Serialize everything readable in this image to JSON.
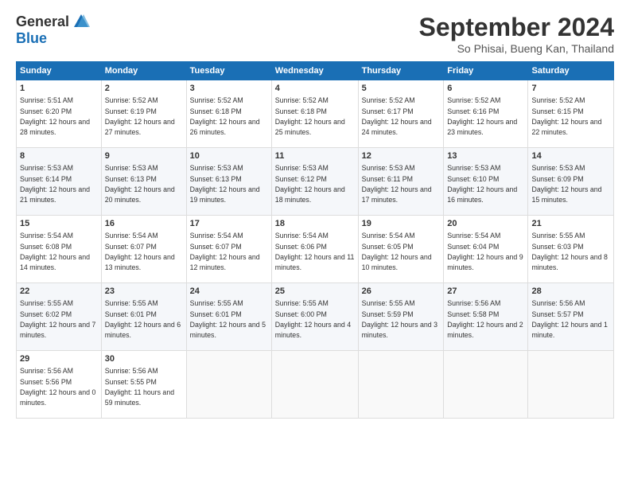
{
  "logo": {
    "general": "General",
    "blue": "Blue"
  },
  "header": {
    "month": "September 2024",
    "location": "So Phisai, Bueng Kan, Thailand"
  },
  "weekdays": [
    "Sunday",
    "Monday",
    "Tuesday",
    "Wednesday",
    "Thursday",
    "Friday",
    "Saturday"
  ],
  "weeks": [
    [
      {
        "day": "1",
        "sunrise": "5:51 AM",
        "sunset": "6:20 PM",
        "daylight": "12 hours and 28 minutes."
      },
      {
        "day": "2",
        "sunrise": "5:52 AM",
        "sunset": "6:19 PM",
        "daylight": "12 hours and 27 minutes."
      },
      {
        "day": "3",
        "sunrise": "5:52 AM",
        "sunset": "6:18 PM",
        "daylight": "12 hours and 26 minutes."
      },
      {
        "day": "4",
        "sunrise": "5:52 AM",
        "sunset": "6:18 PM",
        "daylight": "12 hours and 25 minutes."
      },
      {
        "day": "5",
        "sunrise": "5:52 AM",
        "sunset": "6:17 PM",
        "daylight": "12 hours and 24 minutes."
      },
      {
        "day": "6",
        "sunrise": "5:52 AM",
        "sunset": "6:16 PM",
        "daylight": "12 hours and 23 minutes."
      },
      {
        "day": "7",
        "sunrise": "5:52 AM",
        "sunset": "6:15 PM",
        "daylight": "12 hours and 22 minutes."
      }
    ],
    [
      {
        "day": "8",
        "sunrise": "5:53 AM",
        "sunset": "6:14 PM",
        "daylight": "12 hours and 21 minutes."
      },
      {
        "day": "9",
        "sunrise": "5:53 AM",
        "sunset": "6:13 PM",
        "daylight": "12 hours and 20 minutes."
      },
      {
        "day": "10",
        "sunrise": "5:53 AM",
        "sunset": "6:13 PM",
        "daylight": "12 hours and 19 minutes."
      },
      {
        "day": "11",
        "sunrise": "5:53 AM",
        "sunset": "6:12 PM",
        "daylight": "12 hours and 18 minutes."
      },
      {
        "day": "12",
        "sunrise": "5:53 AM",
        "sunset": "6:11 PM",
        "daylight": "12 hours and 17 minutes."
      },
      {
        "day": "13",
        "sunrise": "5:53 AM",
        "sunset": "6:10 PM",
        "daylight": "12 hours and 16 minutes."
      },
      {
        "day": "14",
        "sunrise": "5:53 AM",
        "sunset": "6:09 PM",
        "daylight": "12 hours and 15 minutes."
      }
    ],
    [
      {
        "day": "15",
        "sunrise": "5:54 AM",
        "sunset": "6:08 PM",
        "daylight": "12 hours and 14 minutes."
      },
      {
        "day": "16",
        "sunrise": "5:54 AM",
        "sunset": "6:07 PM",
        "daylight": "12 hours and 13 minutes."
      },
      {
        "day": "17",
        "sunrise": "5:54 AM",
        "sunset": "6:07 PM",
        "daylight": "12 hours and 12 minutes."
      },
      {
        "day": "18",
        "sunrise": "5:54 AM",
        "sunset": "6:06 PM",
        "daylight": "12 hours and 11 minutes."
      },
      {
        "day": "19",
        "sunrise": "5:54 AM",
        "sunset": "6:05 PM",
        "daylight": "12 hours and 10 minutes."
      },
      {
        "day": "20",
        "sunrise": "5:54 AM",
        "sunset": "6:04 PM",
        "daylight": "12 hours and 9 minutes."
      },
      {
        "day": "21",
        "sunrise": "5:55 AM",
        "sunset": "6:03 PM",
        "daylight": "12 hours and 8 minutes."
      }
    ],
    [
      {
        "day": "22",
        "sunrise": "5:55 AM",
        "sunset": "6:02 PM",
        "daylight": "12 hours and 7 minutes."
      },
      {
        "day": "23",
        "sunrise": "5:55 AM",
        "sunset": "6:01 PM",
        "daylight": "12 hours and 6 minutes."
      },
      {
        "day": "24",
        "sunrise": "5:55 AM",
        "sunset": "6:01 PM",
        "daylight": "12 hours and 5 minutes."
      },
      {
        "day": "25",
        "sunrise": "5:55 AM",
        "sunset": "6:00 PM",
        "daylight": "12 hours and 4 minutes."
      },
      {
        "day": "26",
        "sunrise": "5:55 AM",
        "sunset": "5:59 PM",
        "daylight": "12 hours and 3 minutes."
      },
      {
        "day": "27",
        "sunrise": "5:56 AM",
        "sunset": "5:58 PM",
        "daylight": "12 hours and 2 minutes."
      },
      {
        "day": "28",
        "sunrise": "5:56 AM",
        "sunset": "5:57 PM",
        "daylight": "12 hours and 1 minute."
      }
    ],
    [
      {
        "day": "29",
        "sunrise": "5:56 AM",
        "sunset": "5:56 PM",
        "daylight": "12 hours and 0 minutes."
      },
      {
        "day": "30",
        "sunrise": "5:56 AM",
        "sunset": "5:55 PM",
        "daylight": "11 hours and 59 minutes."
      },
      null,
      null,
      null,
      null,
      null
    ]
  ],
  "labels": {
    "sunrise": "Sunrise:",
    "sunset": "Sunset:",
    "daylight": "Daylight:"
  }
}
